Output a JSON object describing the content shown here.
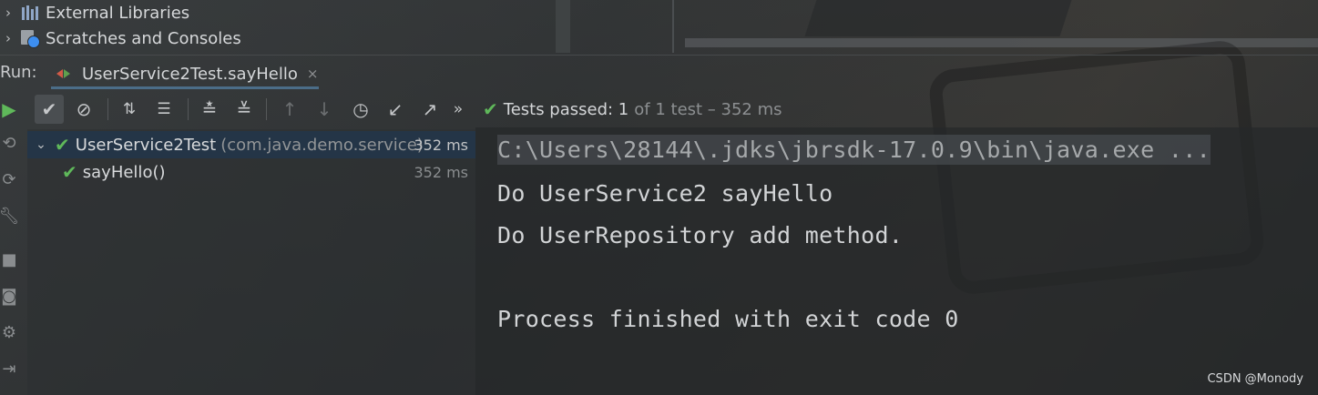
{
  "project_tree": {
    "items": [
      {
        "label": "External Libraries",
        "icon": "library-icon"
      },
      {
        "label": "Scratches and Consoles",
        "icon": "scratches-icon"
      }
    ]
  },
  "run_bar": {
    "label": "Run:",
    "tab_title": "UserService2Test.sayHello",
    "tab_close": "×"
  },
  "toolbar": {
    "more": "»",
    "status_main": "Tests passed: 1",
    "status_rest": "of 1 test – 352 ms"
  },
  "test_tree": {
    "root": {
      "name": "UserService2Test",
      "package": "(com.java.demo.service)",
      "time": "352 ms"
    },
    "children": [
      {
        "name": "sayHello()",
        "time": "352 ms"
      }
    ]
  },
  "console": {
    "lines": [
      "C:\\Users\\28144\\.jdks\\jbrsdk-17.0.9\\bin\\java.exe ...",
      "Do UserService2 sayHello",
      "Do UserRepository add method.",
      "",
      "Process finished with exit code 0"
    ]
  },
  "watermark": "CSDN @Monody",
  "colors": {
    "pass_green": "#5fb85a",
    "selection": "#243547"
  }
}
